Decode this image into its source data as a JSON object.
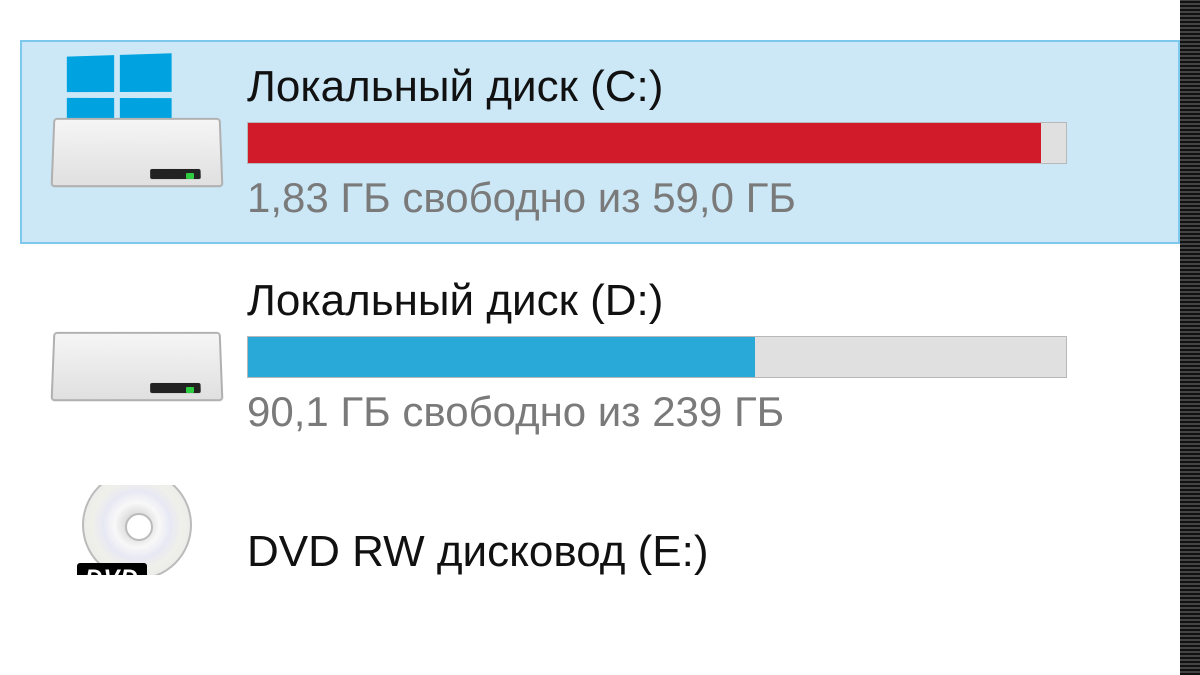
{
  "drives": [
    {
      "name": "Локальный диск (C:)",
      "status": "1,83 ГБ свободно из 59,0 ГБ",
      "fill_percent": 97,
      "critical": true,
      "selected": true,
      "type": "system"
    },
    {
      "name": "Локальный диск (D:)",
      "status": "90,1 ГБ свободно из 239 ГБ",
      "fill_percent": 62,
      "critical": false,
      "selected": false,
      "type": "local"
    },
    {
      "name": "DVD RW дисковод (E:)",
      "status": "",
      "fill_percent": 0,
      "critical": false,
      "selected": false,
      "type": "dvd"
    }
  ]
}
